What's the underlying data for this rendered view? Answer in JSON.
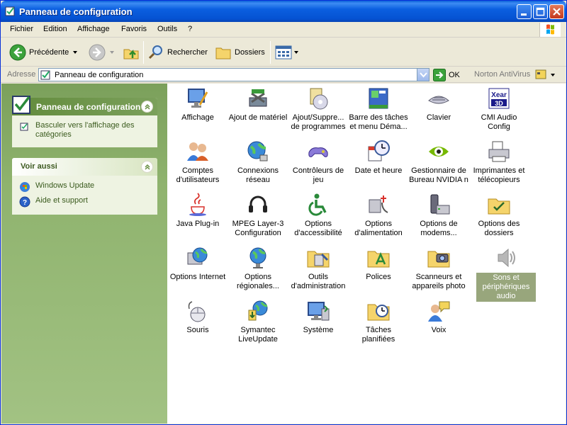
{
  "window": {
    "title": "Panneau de configuration"
  },
  "menu": {
    "items": [
      "Fichier",
      "Edition",
      "Affichage",
      "Favoris",
      "Outils",
      "?"
    ]
  },
  "toolbar": {
    "back": "Précédente",
    "search": "Rechercher",
    "folders": "Dossiers"
  },
  "address": {
    "label": "Adresse",
    "value": "Panneau de configuration",
    "go": "OK",
    "norton": "Norton AntiVirus"
  },
  "left_panel": {
    "main_title": "Panneau de configuration",
    "switch_view": "Basculer vers l'affichage des catégories",
    "see_also_title": "Voir aussi",
    "links": [
      "Windows Update",
      "Aide et support"
    ]
  },
  "items": [
    "Affichage",
    "Ajout de matériel",
    "Ajout/Suppre... de programmes",
    "Barre des tâches et menu Déma...",
    "Clavier",
    "CMI Audio Config",
    "Comptes d'utilisateurs",
    "Connexions réseau",
    "Contrôleurs de jeu",
    "Date et heure",
    "Gestionnaire de Bureau NVIDIA n",
    "Imprimantes et télécopieurs",
    "Java Plug-in",
    "MPEG Layer-3 Configuration",
    "Options d'accessibilité",
    "Options d'alimentation",
    "Options de modems...",
    "Options des dossiers",
    "Options Internet",
    "Options régionales...",
    "Outils d'administration",
    "Polices",
    "Scanneurs et appareils photo",
    "Sons et périphériques audio",
    "Souris",
    "Symantec LiveUpdate",
    "Système",
    "Tâches planifiées",
    "Voix"
  ],
  "selected_item": "Sons et périphériques audio",
  "colors": {
    "titlebar": "#0552d2",
    "left_pane": "#8fb36e",
    "selection": "#98a67c"
  }
}
